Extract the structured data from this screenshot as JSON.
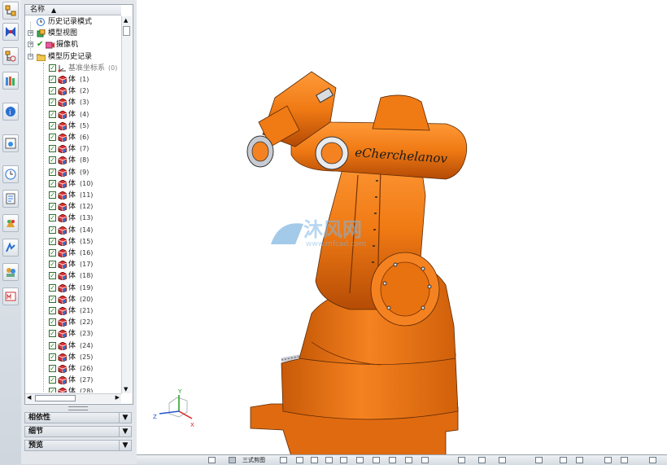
{
  "tree": {
    "header_label": "名称",
    "nodes": [
      {
        "label": "历史记录模式",
        "icon": "clock-icon"
      },
      {
        "label": "模型视图",
        "icon": "model-views-icon"
      },
      {
        "label": "摄像机",
        "icon": "camera-icon"
      },
      {
        "label": "模型历史记录",
        "icon": "folder-icon"
      },
      {
        "label": "基准坐标系",
        "index": "(0)",
        "icon": "datum-csys-icon"
      }
    ],
    "body_label": "体",
    "bodies": [
      "(1)",
      "(2)",
      "(3)",
      "(4)",
      "(5)",
      "(6)",
      "(7)",
      "(8)",
      "(9)",
      "(10)",
      "(11)",
      "(12)",
      "(13)",
      "(14)",
      "(15)",
      "(16)",
      "(17)",
      "(18)",
      "(19)",
      "(20)",
      "(21)",
      "(22)",
      "(23)",
      "(24)",
      "(25)",
      "(26)",
      "(27)",
      "(28)"
    ]
  },
  "sections": [
    "相依性",
    "细节",
    "预览"
  ],
  "model": {
    "arm_text": "eCherchelanov",
    "watermark_cn": "沐风网",
    "watermark_url": "www.mfcad.com",
    "colors": {
      "body": "#f07a14",
      "shadow": "#b34a05",
      "highlight": "#ffb060",
      "ring": "#c8ccd2"
    }
  },
  "triad": {
    "x_label": "X",
    "y_label": "Y",
    "z_label": "Z"
  },
  "bottom_bar": {
    "label": "三式剪图"
  }
}
